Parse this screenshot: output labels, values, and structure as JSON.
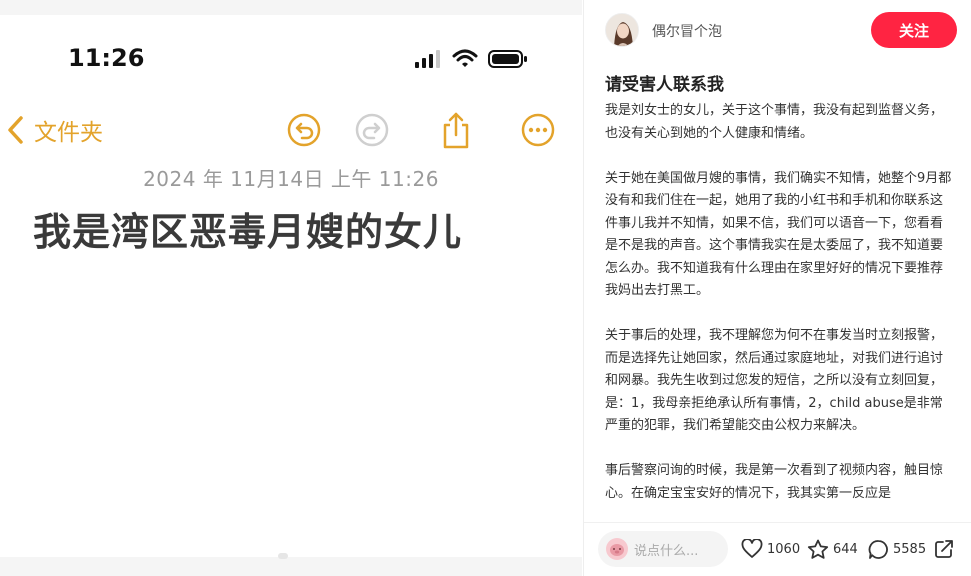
{
  "note": {
    "status_time": "11:26",
    "back_label": "文件夹",
    "date": "2024 年 11月14日 上午 11:26",
    "title": "我是湾区恶毒月嫂的女儿"
  },
  "post": {
    "author": "偶尔冒个泡",
    "follow_label": "关注",
    "title": "请受害人联系我",
    "paragraphs": [
      "我是刘女士的女儿，关于这个事情，我没有起到监督义务，也没有关心到她的个人健康和情绪。",
      "关于她在美国做月嫂的事情，我们确实不知情，她整个9月都没有和我们住在一起，她用了我的小红书和手机和你联系这件事儿我并不知情，如果不信，我们可以语音一下，您看看是不是我的声音。这个事情我实在是太委屈了，我不知道要怎么办。我不知道我有什么理由在家里好好的情况下要推荐我妈出去打黑工。",
      "关于事后的处理，我不理解您为何不在事发当时立刻报警，而是选择先让她回家，然后通过家庭地址，对我们进行追讨和网暴。我先生收到过您发的短信，之所以没有立刻回复，是：1，我母亲拒绝承认所有事情，2，child abuse是非常严重的犯罪，我们希望能交由公权力来解决。",
      "事后警察问询的时候，我是第一次看到了视频内容，触目惊心。在确定宝宝安好的情况下，我其实第一反应是"
    ]
  },
  "bottom": {
    "comment_placeholder": "说点什么...",
    "likes": "1060",
    "stars": "644",
    "comments": "5585"
  },
  "colors": {
    "accent": "#ff2442",
    "notes_yellow": "#e3a32b"
  }
}
